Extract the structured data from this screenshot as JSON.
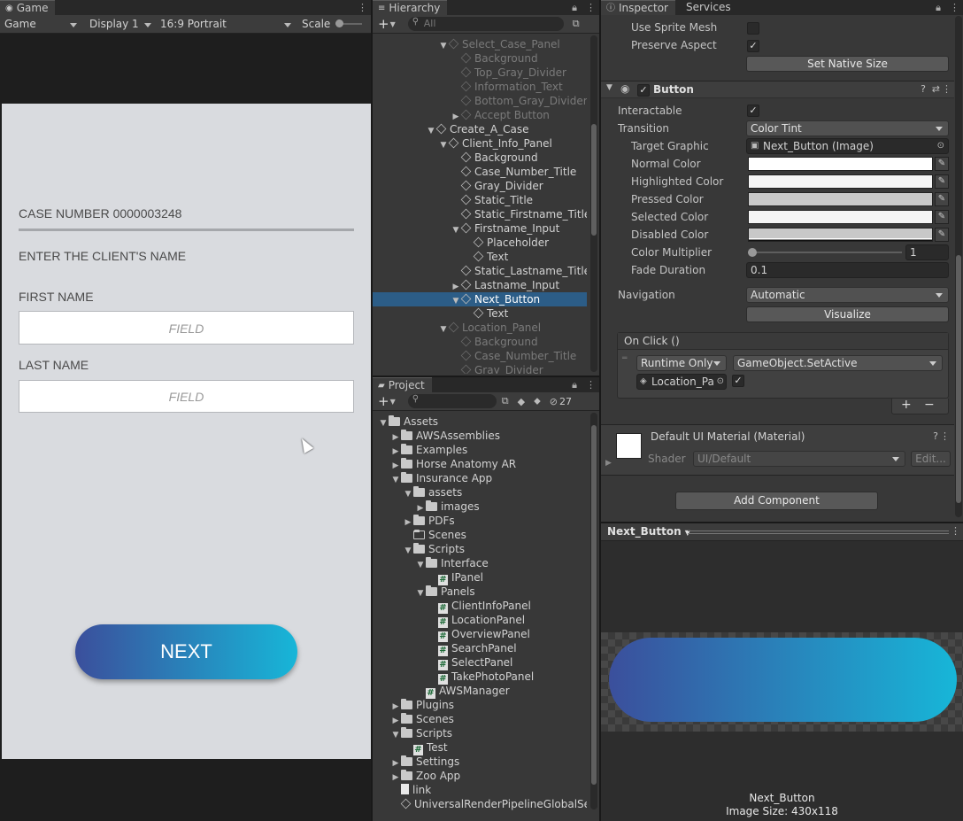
{
  "game": {
    "tab": "Game",
    "mode": "Game",
    "display": "Display 1",
    "aspect": "16:9 Portrait",
    "scale_label": "Scale",
    "case_number": "CASE NUMBER 0000003248",
    "prompt": "ENTER THE CLIENT'S NAME",
    "first_label": "FIRST NAME",
    "first_placeholder": "FIELD",
    "last_label": "LAST NAME",
    "last_placeholder": "FIELD",
    "next": "NEXT"
  },
  "hierarchy": {
    "tab": "Hierarchy",
    "search_placeholder": "All",
    "rows": [
      {
        "text": "Select_Case_Panel",
        "d": 5,
        "arr": "▼",
        "dim": true
      },
      {
        "text": "Background",
        "d": 6,
        "arr": "",
        "dim": true
      },
      {
        "text": "Top_Gray_Divider",
        "d": 6,
        "arr": "",
        "dim": true
      },
      {
        "text": "Information_Text",
        "d": 6,
        "arr": "",
        "dim": true
      },
      {
        "text": "Bottom_Gray_Divider",
        "d": 6,
        "arr": "",
        "dim": true
      },
      {
        "text": "Accept Button",
        "d": 6,
        "arr": "▶",
        "dim": true
      },
      {
        "text": "Create_A_Case",
        "d": 4,
        "arr": "▼"
      },
      {
        "text": "Client_Info_Panel",
        "d": 5,
        "arr": "▼"
      },
      {
        "text": "Background",
        "d": 6,
        "arr": ""
      },
      {
        "text": "Case_Number_Title",
        "d": 6,
        "arr": ""
      },
      {
        "text": "Gray_Divider",
        "d": 6,
        "arr": ""
      },
      {
        "text": "Static_Title",
        "d": 6,
        "arr": ""
      },
      {
        "text": "Static_Firstname_Title",
        "d": 6,
        "arr": ""
      },
      {
        "text": "Firstname_Input",
        "d": 6,
        "arr": "▼"
      },
      {
        "text": "Placeholder",
        "d": 7,
        "arr": ""
      },
      {
        "text": "Text",
        "d": 7,
        "arr": ""
      },
      {
        "text": "Static_Lastname_Title",
        "d": 6,
        "arr": ""
      },
      {
        "text": "Lastname_Input",
        "d": 6,
        "arr": "▶"
      },
      {
        "text": "Next_Button",
        "d": 6,
        "arr": "▼",
        "sel": true
      },
      {
        "text": "Text",
        "d": 7,
        "arr": ""
      },
      {
        "text": "Location_Panel",
        "d": 5,
        "arr": "▼",
        "dim": true
      },
      {
        "text": "Background",
        "d": 6,
        "arr": "",
        "dim": true
      },
      {
        "text": "Case_Number_Title",
        "d": 6,
        "arr": "",
        "dim": true
      },
      {
        "text": "Gray_Divider",
        "d": 6,
        "arr": "",
        "dim": true
      }
    ]
  },
  "project": {
    "tab": "Project",
    "hidden_count": "27",
    "rows": [
      {
        "text": "Assets",
        "d": 0,
        "arr": "▼",
        "icon": "folder"
      },
      {
        "text": "AWSAssemblies",
        "d": 1,
        "arr": "▶",
        "icon": "folder"
      },
      {
        "text": "Examples",
        "d": 1,
        "arr": "▶",
        "icon": "folder"
      },
      {
        "text": "Horse Anatomy AR",
        "d": 1,
        "arr": "▶",
        "icon": "folder"
      },
      {
        "text": "Insurance App",
        "d": 1,
        "arr": "▼",
        "icon": "folder"
      },
      {
        "text": "assets",
        "d": 2,
        "arr": "▼",
        "icon": "folder"
      },
      {
        "text": "images",
        "d": 3,
        "arr": "▶",
        "icon": "folder"
      },
      {
        "text": "PDFs",
        "d": 2,
        "arr": "▶",
        "icon": "folder"
      },
      {
        "text": "Scenes",
        "d": 2,
        "arr": "",
        "icon": "folder-empty"
      },
      {
        "text": "Scripts",
        "d": 2,
        "arr": "▼",
        "icon": "folder"
      },
      {
        "text": "Interface",
        "d": 3,
        "arr": "▼",
        "icon": "folder"
      },
      {
        "text": "IPanel",
        "d": 4,
        "arr": "",
        "icon": "script"
      },
      {
        "text": "Panels",
        "d": 3,
        "arr": "▼",
        "icon": "folder"
      },
      {
        "text": "ClientInfoPanel",
        "d": 4,
        "arr": "",
        "icon": "script"
      },
      {
        "text": "LocationPanel",
        "d": 4,
        "arr": "",
        "icon": "script"
      },
      {
        "text": "OverviewPanel",
        "d": 4,
        "arr": "",
        "icon": "script"
      },
      {
        "text": "SearchPanel",
        "d": 4,
        "arr": "",
        "icon": "script"
      },
      {
        "text": "SelectPanel",
        "d": 4,
        "arr": "",
        "icon": "script"
      },
      {
        "text": "TakePhotoPanel",
        "d": 4,
        "arr": "",
        "icon": "script"
      },
      {
        "text": "AWSManager",
        "d": 3,
        "arr": "",
        "icon": "script"
      },
      {
        "text": "Plugins",
        "d": 1,
        "arr": "▶",
        "icon": "folder"
      },
      {
        "text": "Scenes",
        "d": 1,
        "arr": "▶",
        "icon": "folder"
      },
      {
        "text": "Scripts",
        "d": 1,
        "arr": "▼",
        "icon": "folder"
      },
      {
        "text": "Test",
        "d": 2,
        "arr": "",
        "icon": "script"
      },
      {
        "text": "Settings",
        "d": 1,
        "arr": "▶",
        "icon": "folder"
      },
      {
        "text": "Zoo App",
        "d": 1,
        "arr": "▶",
        "icon": "folder"
      },
      {
        "text": "link",
        "d": 1,
        "arr": "",
        "icon": "doc"
      },
      {
        "text": "UniversalRenderPipelineGlobalSet",
        "d": 1,
        "arr": "",
        "icon": "asset"
      }
    ]
  },
  "inspector": {
    "tab": "Inspector",
    "tab2": "Services",
    "use_sprite_mesh": "Use Sprite Mesh",
    "preserve_aspect": "Preserve Aspect",
    "set_native_size": "Set Native Size",
    "component": "Button",
    "interactable": "Interactable",
    "transition": "Transition",
    "transition_value": "Color Tint",
    "target_graphic": "Target Graphic",
    "target_graphic_value": "Next_Button (Image)",
    "normal_color": "Normal Color",
    "highlighted_color": "Highlighted Color",
    "pressed_color": "Pressed Color",
    "selected_color": "Selected Color",
    "disabled_color": "Disabled Color",
    "color_multiplier": "Color Multiplier",
    "color_multiplier_value": "1",
    "fade_duration": "Fade Duration",
    "fade_duration_value": "0.1",
    "navigation": "Navigation",
    "navigation_value": "Automatic",
    "visualize": "Visualize",
    "on_click": "On Click ()",
    "runtime": "Runtime Only",
    "method": "GameObject.SetActive",
    "target_obj": "Location_Pa",
    "material": "Default UI Material (Material)",
    "shader_label": "Shader",
    "shader_value": "UI/Default",
    "edit": "Edit...",
    "add_component": "Add Component",
    "preview_title": "Next_Button",
    "preview_name": "Next_Button",
    "image_size": "Image Size: 430x118"
  },
  "colors": {
    "gradient_start": "#3b4f9c",
    "gradient_end": "#17b6d8",
    "selection": "#2c5d87"
  }
}
